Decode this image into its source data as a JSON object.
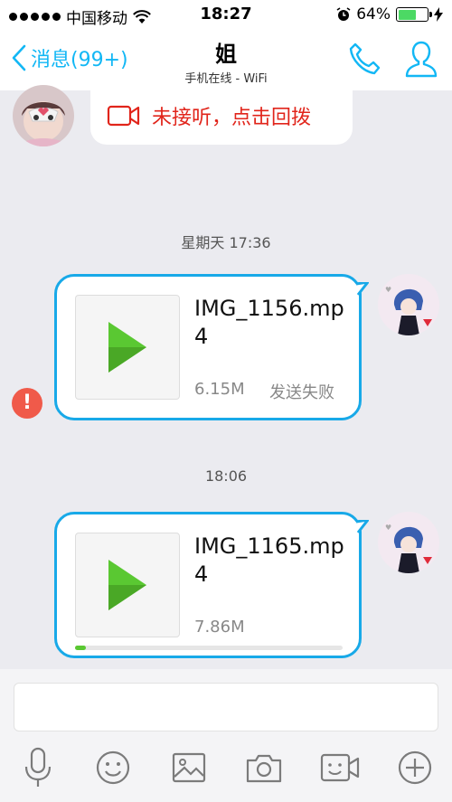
{
  "status_bar": {
    "carrier": "中国移动",
    "time": "18:27",
    "battery": "64%",
    "battery_level": 0.64
  },
  "nav": {
    "back_label": "消息(99+)",
    "title": "姐",
    "subtitle": "手机在线 - WiFi"
  },
  "messages": {
    "missed_call": "未接听，点击回拨",
    "ts1": "星期天 17:36",
    "video1": {
      "name": "IMG_1156.mp4",
      "size": "6.15M",
      "status": "发送失败"
    },
    "error_icon": "!",
    "ts2": "18:06",
    "video2": {
      "name": "IMG_1165.mp4",
      "size": "7.86M",
      "progress": 0.04
    }
  },
  "colors": {
    "accent": "#12b7f5",
    "bubble_border": "#18a9e8",
    "missed_call": "#e1251b",
    "play": "#5ac832",
    "error": "#f05a4a"
  },
  "toolbar": {
    "icons": [
      "microphone-icon",
      "emoji-icon",
      "image-icon",
      "camera-icon",
      "video-call-icon",
      "plus-icon"
    ]
  }
}
